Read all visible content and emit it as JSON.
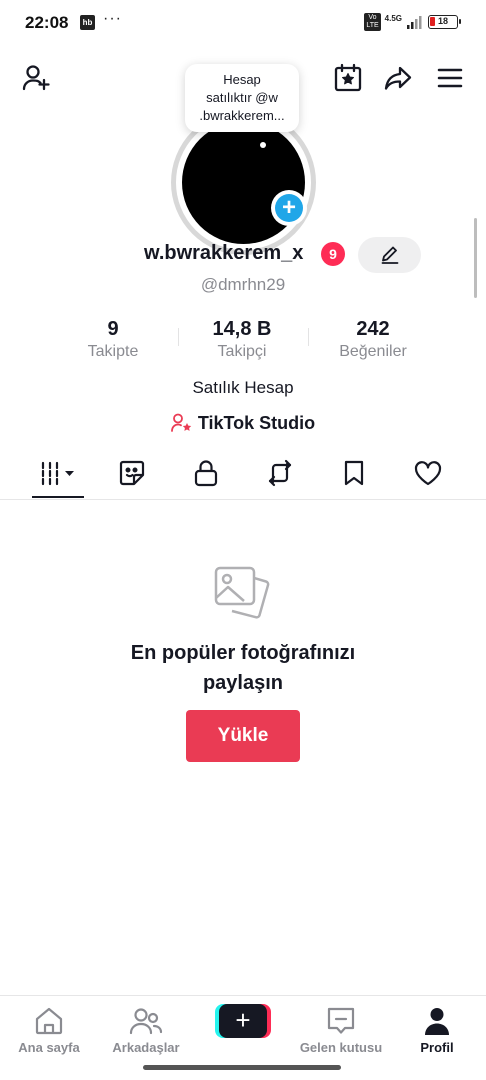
{
  "status_bar": {
    "time": "22:08",
    "app_badge": "hb",
    "more": "···",
    "volte": "Vo LTE",
    "network": "4.5G",
    "battery": "18"
  },
  "bubble": {
    "line1": "Hesap",
    "line2": "satılıktır @w",
    "line3": ".bwrakkerem..."
  },
  "profile": {
    "display_name": "w.bwrakkerem_x",
    "badge_count": "9",
    "username": "@dmrhn29",
    "bio": "Satılık Hesap",
    "studio_label": "TikTok Studio"
  },
  "stats": [
    {
      "value": "9",
      "label": "Takipte"
    },
    {
      "value": "14,8 B",
      "label": "Takipçi"
    },
    {
      "value": "242",
      "label": "Beğeniler"
    }
  ],
  "tabs": [
    "videos-grid",
    "sticker",
    "lock",
    "repost",
    "bookmark",
    "heart"
  ],
  "empty_state": {
    "title_line1": "En popüler fotoğrafınızı",
    "title_line2": "paylaşın",
    "button": "Yükle"
  },
  "bottom_nav": {
    "home": "Ana sayfa",
    "friends": "Arkadaşlar",
    "create": "+",
    "inbox": "Gelen kutusu",
    "profile": "Profil"
  },
  "colors": {
    "accent": "#fe2c55",
    "button": "#ea3b54",
    "blue": "#20a6e8",
    "muted": "#8a8b91"
  }
}
